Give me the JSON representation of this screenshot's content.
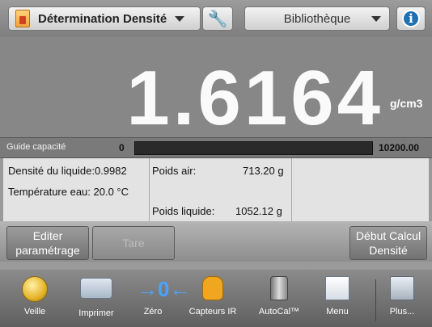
{
  "header": {
    "app_title": "Détermination Densité",
    "library_label": "Bibliothèque",
    "app_icon": "density-beaker-icon",
    "settings_icon": "wrench-icon",
    "info_icon": "info-icon",
    "info_glyph": "i"
  },
  "display": {
    "reading": "1.6164",
    "unit": "g/cm3"
  },
  "capacity": {
    "label": "Guide capacité",
    "min": "0",
    "max": "10200.00"
  },
  "info_panel": {
    "liquid_density": "Densité du liquide:0.9982",
    "water_temp": "Température eau: 20.0 °C",
    "weight_air_label": "Poids air:",
    "weight_air_value": "713.20 g",
    "weight_liquid_label": "Poids liquide:",
    "weight_liquid_value": "1052.12 g"
  },
  "softkeys": {
    "edit_line1": "Editer",
    "edit_line2": "paramétrage",
    "tare": "Tare",
    "start_line1": "Début Calcul",
    "start_line2": "Densité"
  },
  "nav": [
    {
      "label": "Veille",
      "icon": "standby-icon"
    },
    {
      "label": "Imprimer",
      "icon": "printer-icon"
    },
    {
      "label": "Zéro",
      "icon": "zero-icon"
    },
    {
      "label": "Capteurs IR",
      "icon": "ir-sensor-hand-icon"
    },
    {
      "label": "AutoCal™",
      "icon": "calibration-weight-icon"
    },
    {
      "label": "Menu",
      "icon": "menu-icon"
    },
    {
      "label": "Plus...",
      "icon": "more-icon"
    }
  ]
}
